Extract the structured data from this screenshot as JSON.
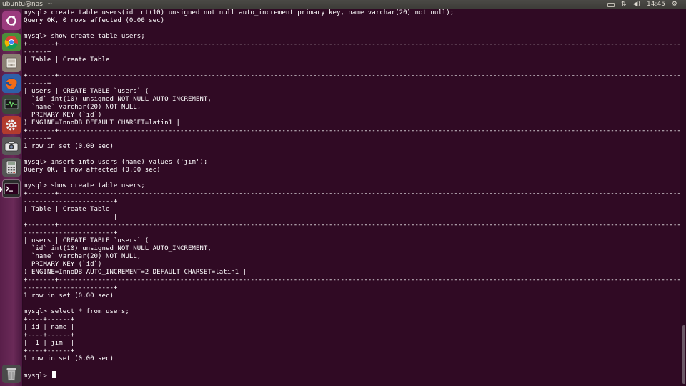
{
  "topbar": {
    "window_title": "ubuntu@nas: ~",
    "time": "14:45"
  },
  "launcher": {
    "items": [
      {
        "name": "dash-home",
        "icon": "ubuntu-logo-icon"
      },
      {
        "name": "chrome",
        "icon": "chrome-icon"
      },
      {
        "name": "files",
        "icon": "file-cabinet-icon"
      },
      {
        "name": "firefox",
        "icon": "firefox-icon"
      },
      {
        "name": "system-monitor",
        "icon": "system-monitor-icon"
      },
      {
        "name": "system-settings",
        "icon": "settings-gear-icon"
      },
      {
        "name": "camera",
        "icon": "camera-icon"
      },
      {
        "name": "calculator",
        "icon": "calculator-icon"
      },
      {
        "name": "terminal",
        "icon": "terminal-icon"
      },
      {
        "name": "trash",
        "icon": "trash-icon"
      }
    ]
  },
  "terminal": {
    "lines": [
      "mysql> create table users(id int(10) unsigned not null auto_increment primary key, name varchar(20) not null);",
      "Query OK, 0 rows affected (0.00 sec)",
      "",
      "mysql> show create table users;",
      "+-------+---------------------------------------------------------------------------------------------------------------------------------------------------------------------------------------+",
      "------+",
      "| Table | Create Table",
      "      |",
      "+-------+---------------------------------------------------------------------------------------------------------------------------------------------------------------------------------------+",
      "------+",
      "| users | CREATE TABLE `users` (",
      "  `id` int(10) unsigned NOT NULL AUTO_INCREMENT,",
      "  `name` varchar(20) NOT NULL,",
      "  PRIMARY KEY (`id`)",
      ") ENGINE=InnoDB DEFAULT CHARSET=latin1 |",
      "+-------+---------------------------------------------------------------------------------------------------------------------------------------------------------------------------------------+",
      "------+",
      "1 row in set (0.00 sec)",
      "",
      "mysql> insert into users (name) values ('jim');",
      "Query OK, 1 row affected (0.00 sec)",
      "",
      "mysql> show create table users;",
      "+-------+---------------------------------------------------------------------------------------------------------------------------------------------------------------------------------------+",
      "-----------------------+",
      "| Table | Create Table",
      "                       |",
      "+-------+---------------------------------------------------------------------------------------------------------------------------------------------------------------------------------------+",
      "-----------------------+",
      "| users | CREATE TABLE `users` (",
      "  `id` int(10) unsigned NOT NULL AUTO_INCREMENT,",
      "  `name` varchar(20) NOT NULL,",
      "  PRIMARY KEY (`id`)",
      ") ENGINE=InnoDB AUTO_INCREMENT=2 DEFAULT CHARSET=latin1 |",
      "+-------+---------------------------------------------------------------------------------------------------------------------------------------------------------------------------------------+",
      "-----------------------+",
      "1 row in set (0.00 sec)",
      "",
      "mysql> select * from users;",
      "+----+------+",
      "| id | name |",
      "+----+------+",
      "|  1 | jim  |",
      "+----+------+",
      "1 row in set (0.00 sec)",
      ""
    ],
    "prompt": "mysql> "
  }
}
